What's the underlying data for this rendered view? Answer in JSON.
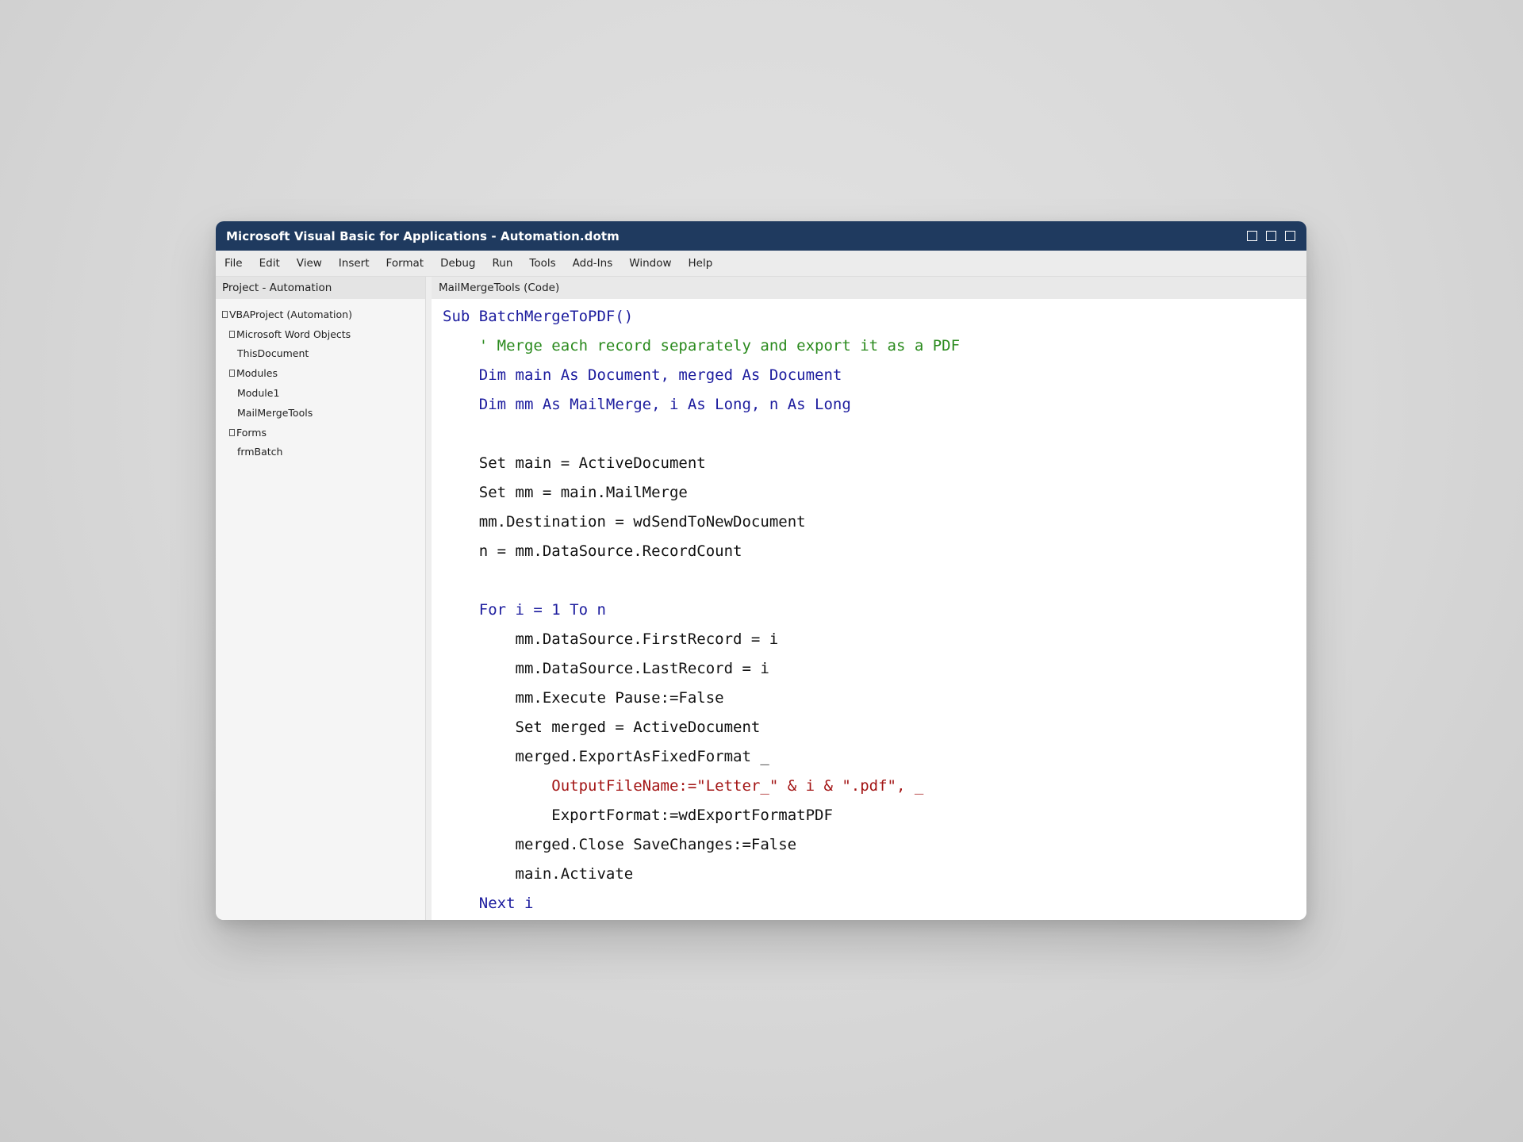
{
  "window": {
    "title": "Microsoft Visual Basic for Applications - Automation.dotm"
  },
  "menu": [
    "File",
    "Edit",
    "View",
    "Insert",
    "Format",
    "Debug",
    "Run",
    "Tools",
    "Add-Ins",
    "Window",
    "Help"
  ],
  "project_panel": {
    "header": "Project - Automation",
    "tree": [
      {
        "label": "VBAProject (Automation)",
        "level": 0,
        "expander": true
      },
      {
        "label": "Microsoft Word Objects",
        "level": 1,
        "expander": true
      },
      {
        "label": "ThisDocument",
        "level": 2,
        "expander": false
      },
      {
        "label": "Modules",
        "level": 1,
        "expander": true
      },
      {
        "label": "Module1",
        "level": 2,
        "expander": false
      },
      {
        "label": "MailMergeTools",
        "level": 2,
        "expander": false
      },
      {
        "label": "Forms",
        "level": 1,
        "expander": true
      },
      {
        "label": "frmBatch",
        "level": 2,
        "expander": false
      }
    ]
  },
  "code_panel": {
    "header": "MailMergeTools (Code)",
    "colors": {
      "keyword": "#1c1c9e",
      "comment": "#2a8a1d",
      "string": "#a31515",
      "plain": "#111111"
    },
    "lines": [
      {
        "indent": 0,
        "text": "Sub BatchMergeToPDF()",
        "style": "kw"
      },
      {
        "indent": 1,
        "text": "' Merge each record separately and export it as a PDF",
        "style": "cm"
      },
      {
        "indent": 1,
        "text": "Dim main As Document, merged As Document",
        "style": "kw"
      },
      {
        "indent": 1,
        "text": "Dim mm As MailMerge, i As Long, n As Long",
        "style": "kw"
      },
      {
        "indent": 0,
        "text": "",
        "style": "pl"
      },
      {
        "indent": 1,
        "text": "Set main = ActiveDocument",
        "style": "pl"
      },
      {
        "indent": 1,
        "text": "Set mm = main.MailMerge",
        "style": "pl"
      },
      {
        "indent": 1,
        "text": "mm.Destination = wdSendToNewDocument",
        "style": "pl"
      },
      {
        "indent": 1,
        "text": "n = mm.DataSource.RecordCount",
        "style": "pl"
      },
      {
        "indent": 0,
        "text": "",
        "style": "pl"
      },
      {
        "indent": 1,
        "text": "For i = 1 To n",
        "style": "kw"
      },
      {
        "indent": 2,
        "text": "mm.DataSource.FirstRecord = i",
        "style": "pl"
      },
      {
        "indent": 2,
        "text": "mm.DataSource.LastRecord = i",
        "style": "pl"
      },
      {
        "indent": 2,
        "text": "mm.Execute Pause:=False",
        "style": "pl"
      },
      {
        "indent": 2,
        "text": "Set merged = ActiveDocument",
        "style": "pl"
      },
      {
        "indent": 2,
        "text": "merged.ExportAsFixedFormat _",
        "style": "pl"
      },
      {
        "indent": 3,
        "text": "OutputFileName:=\"Letter_\" & i & \".pdf\", _",
        "style": "st"
      },
      {
        "indent": 3,
        "text": "ExportFormat:=wdExportFormatPDF",
        "style": "pl"
      },
      {
        "indent": 2,
        "text": "merged.Close SaveChanges:=False",
        "style": "pl"
      },
      {
        "indent": 2,
        "text": "main.Activate",
        "style": "pl"
      },
      {
        "indent": 1,
        "text": "Next i",
        "style": "kw"
      }
    ]
  }
}
